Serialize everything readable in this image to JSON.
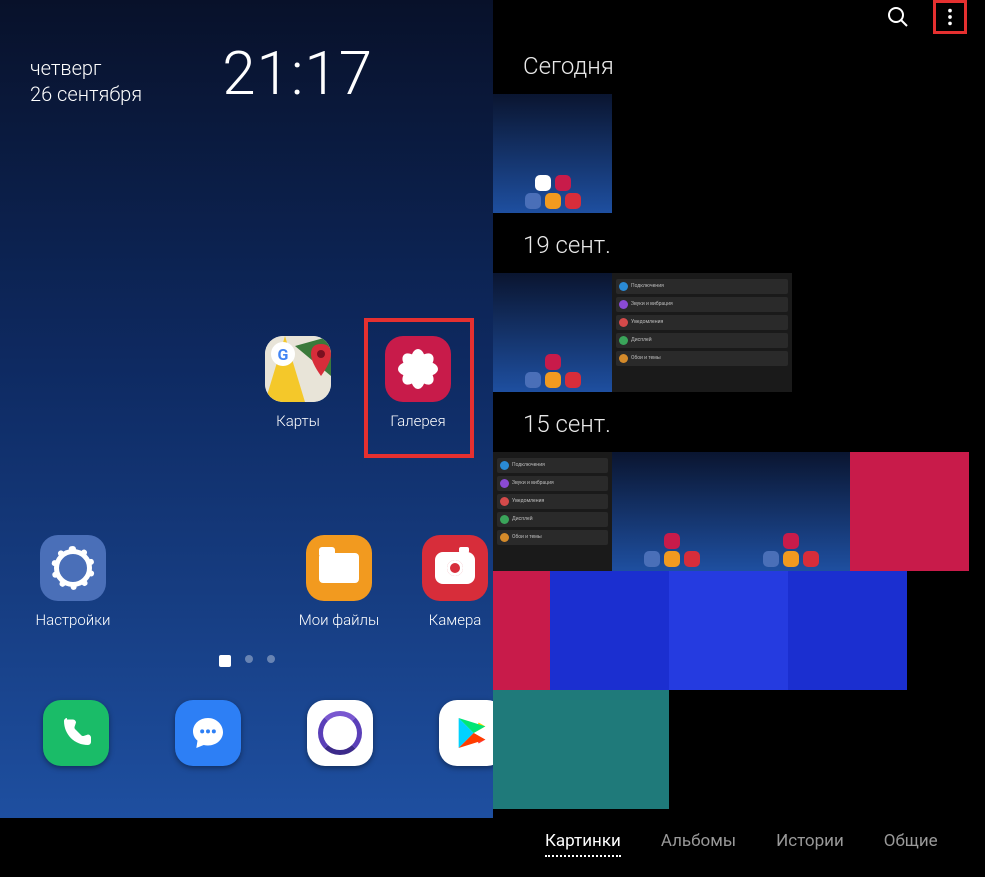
{
  "home": {
    "day": "четверг",
    "date": "26 сентября",
    "time": "21:17",
    "apps": {
      "maps": "Карты",
      "gallery": "Галерея",
      "settings": "Настройки",
      "myfiles": "Мои файлы",
      "camera": "Камера"
    },
    "dock_labels": {
      "phone": "Телефон",
      "messages": "Сообщения",
      "browser": "Интернет",
      "play": "Play Маркет"
    }
  },
  "gallery": {
    "sections": {
      "today": "Сегодня",
      "sep19": "19 сент.",
      "sep15": "15 сент."
    },
    "tabs": {
      "pictures": "Картинки",
      "albums": "Альбомы",
      "stories": "Истории",
      "shared": "Общие"
    },
    "settings_rows": {
      "connections": "Подключения",
      "sounds": "Звуки и вибрация",
      "notifications": "Уведомления",
      "display": "Дисплей",
      "wallpaper": "Обои и темы"
    }
  }
}
